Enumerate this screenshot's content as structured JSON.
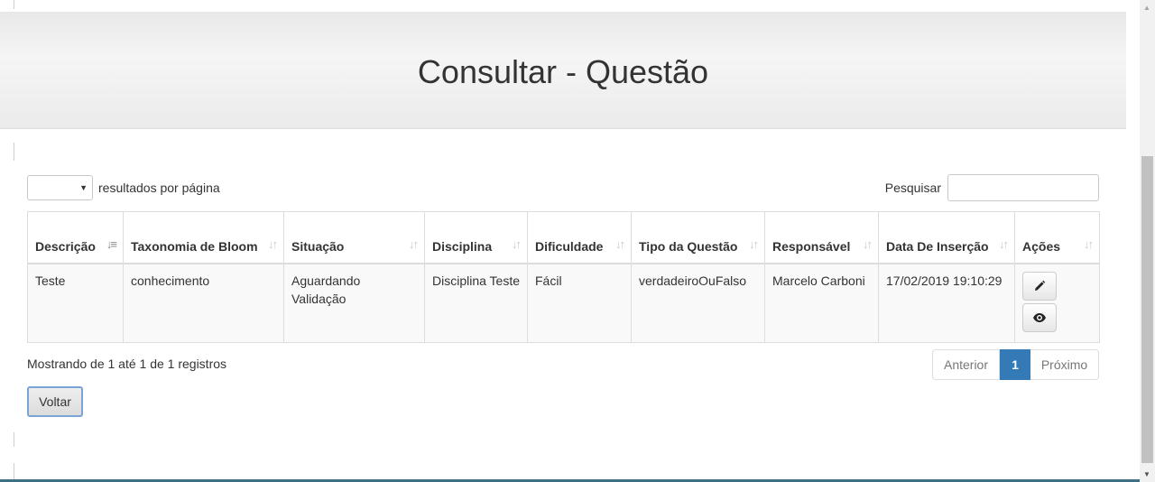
{
  "page": {
    "title": "Consultar - Questão"
  },
  "controls": {
    "length_value": "",
    "length_label": "resultados por página",
    "search_label": "Pesquisar",
    "search_value": ""
  },
  "table": {
    "columns": [
      {
        "label": "Descrição",
        "sort_state": "asc"
      },
      {
        "label": "Taxonomia de Bloom",
        "sort_state": "none"
      },
      {
        "label": "Situação",
        "sort_state": "none"
      },
      {
        "label": "Disciplina",
        "sort_state": "none"
      },
      {
        "label": "Dificuldade",
        "sort_state": "none"
      },
      {
        "label": "Tipo da Questão",
        "sort_state": "none"
      },
      {
        "label": "Responsável",
        "sort_state": "none"
      },
      {
        "label": "Data De Inserção",
        "sort_state": "none"
      },
      {
        "label": "Ações",
        "sort_state": "none"
      }
    ],
    "rows": [
      {
        "descricao": "Teste",
        "taxonomia": "conhecimento",
        "situacao": "Aguardando Validação",
        "disciplina": "Disciplina Teste",
        "dificuldade": "Fácil",
        "tipo": "verdadeiroOuFalso",
        "responsavel": "Marcelo Carboni",
        "data_insercao": "17/02/2019 19:10:29",
        "actions": [
          {
            "icon": "pencil-icon"
          },
          {
            "icon": "eye-icon"
          }
        ]
      }
    ]
  },
  "footer": {
    "info": "Mostrando de 1 até 1 de 1 registros",
    "prev_label": "Anterior",
    "current_page": "1",
    "next_label": "Próximo",
    "back_label": "Voltar"
  },
  "colors": {
    "accent": "#337ab7",
    "header_bg": "#eaeaea",
    "border": "#dddddd"
  }
}
